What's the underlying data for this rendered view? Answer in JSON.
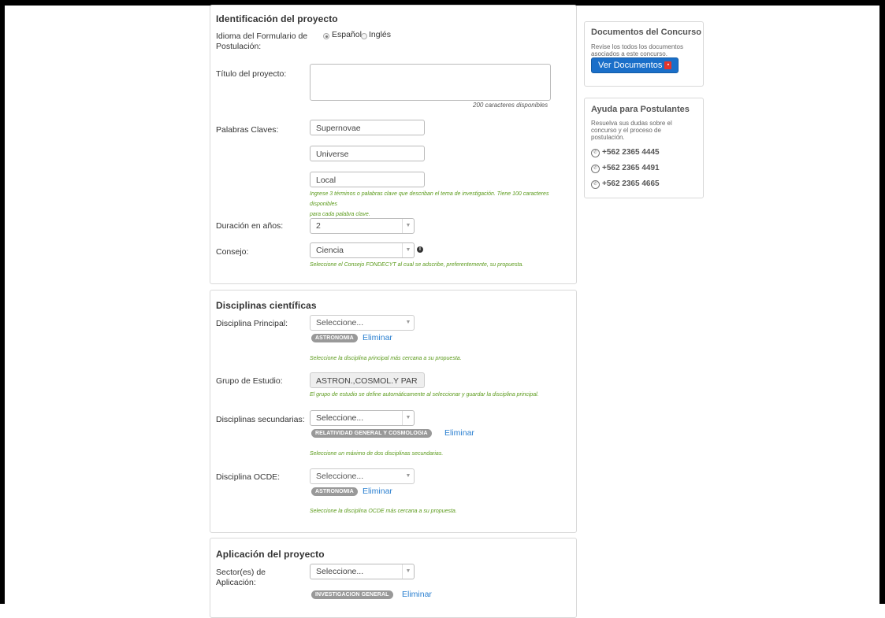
{
  "identificacion": {
    "title": "Identificación del proyecto",
    "idioma_label": "Idioma del Formulario de Postulación:",
    "idioma_opt1": "Español",
    "idioma_opt2": "Inglés",
    "titulo_label": "Título del proyecto:",
    "titulo_value": "",
    "titulo_counter": "200 caracteres disponibles",
    "palabras_label": "Palabras Claves:",
    "palabras": [
      "Supernovae",
      "Universe",
      "Local"
    ],
    "palabras_help_1": "Ingrese 3 términos o palabras clave que describan el tema de investigación. Tiene 100 caracteres disponibles",
    "palabras_help_2": "para cada palabra clave.",
    "duracion_label": "Duración en años:",
    "duracion_value": "2",
    "consejo_label": "Consejo:",
    "consejo_value": "Ciencia",
    "consejo_help": "Seleccione el Consejo FONDECYT al cual se adscribe, preferentemente, su propuesta."
  },
  "disciplinas": {
    "title": "Disciplinas científicas",
    "principal_label": "Disciplina Principal:",
    "principal_select": "Seleccione...",
    "principal_tag": "ASTRONOMIA",
    "principal_remove": "Eliminar",
    "principal_help": "Seleccione la disciplina principal más cercana a su propuesta.",
    "grupo_label": "Grupo de Estudio:",
    "grupo_value": "ASTRON.,COSMOL.Y PAR",
    "grupo_help": "El grupo de estudio se define automáticamente al seleccionar y guardar la disciplina principal.",
    "secundarias_label": "Disciplinas secundarias:",
    "secundarias_select": "Seleccione...",
    "secundarias_tag": "RELATIVIDAD GENERAL Y COSMOLOGIA",
    "secundarias_remove": "Eliminar",
    "secundarias_help": "Seleccione un máximo de dos disciplinas secundarias.",
    "ocde_label": "Disciplina OCDE:",
    "ocde_select": "Seleccione...",
    "ocde_tag": "ASTRONOMIA",
    "ocde_remove": "Eliminar",
    "ocde_help": "Seleccione la disciplina OCDE más cercana a su propuesta."
  },
  "aplicacion": {
    "title": "Aplicación del proyecto",
    "sector_label": "Sector(es) de Aplicación:",
    "sector_select": "Seleccione...",
    "sector_tag": "INVESTIGACION GENERAL",
    "sector_remove": "Eliminar"
  },
  "sidebar": {
    "docs_title": "Documentos del Concurso",
    "docs_text": "Revise los todos los documentos asociados a este concurso.",
    "docs_button": "Ver Documentos",
    "help_title": "Ayuda para Postulantes",
    "help_text": "Resuelva sus dudas sobre el concurso y el proceso de postulación.",
    "phones": [
      "+562 2365 4445",
      "+562 2365 4491",
      "+562 2365 4665"
    ]
  },
  "colors": {
    "accent": "#1a6fc9",
    "help_text": "#5a9a1a",
    "link": "#2a7fd0",
    "tag": "#999999"
  }
}
